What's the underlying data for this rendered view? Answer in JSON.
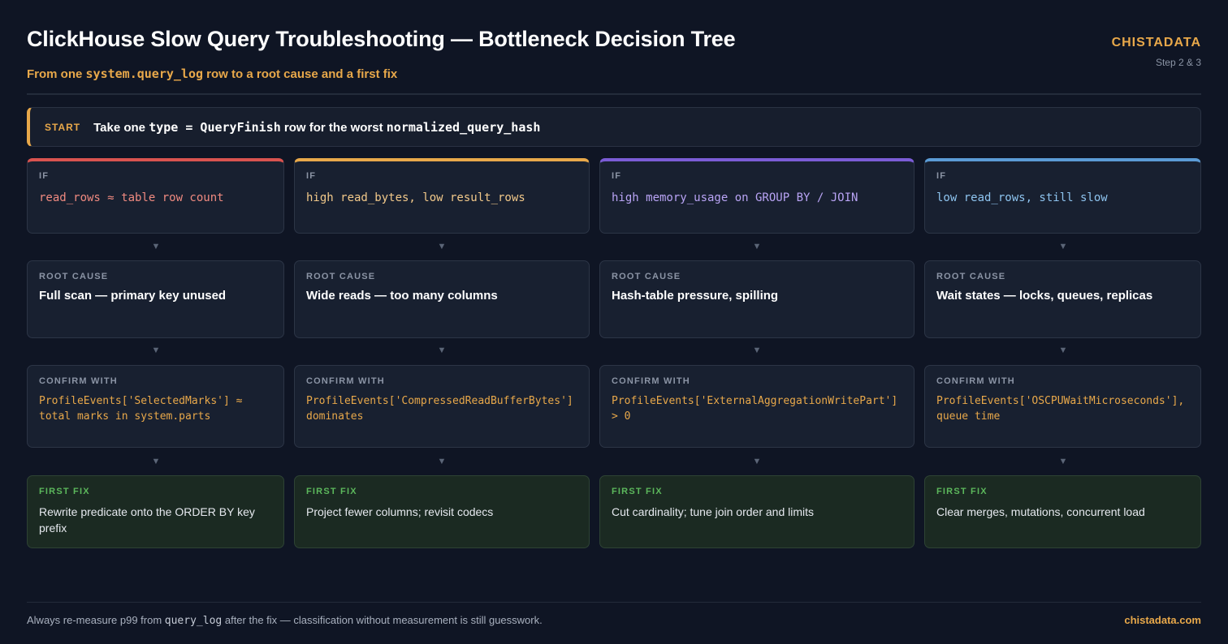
{
  "header": {
    "title": "ClickHouse Slow Query Troubleshooting — Bottleneck Decision Tree",
    "subtitle_pre": "From one ",
    "subtitle_code": "system.query_log",
    "subtitle_post": " row to a root cause and a first fix",
    "brand": "CHISTADATA",
    "step": "Step 2 & 3"
  },
  "start": {
    "tag": "START",
    "text_pre": "Take one ",
    "text_code": "type = QueryFinish",
    "text_mid": " row for the worst ",
    "text_code2": "normalized_query_hash"
  },
  "labels": {
    "if": "IF",
    "root_cause": "ROOT CAUSE",
    "confirm_with": "CONFIRM WITH",
    "first_fix": "FIRST FIX"
  },
  "colors": {
    "accent": "#e8a84a",
    "branch_1": "#d9534f",
    "branch_2": "#e8a84a",
    "branch_3": "#7b5cd6",
    "branch_4": "#5b9bd5"
  },
  "branches": [
    {
      "condition": "read_rows ≈ table row count",
      "cause": "Full scan — primary key unused",
      "confirm": "ProfileEvents['SelectedMarks'] ≈ total marks in system.parts",
      "fix": "Rewrite predicate onto the ORDER BY key prefix"
    },
    {
      "condition": "high read_bytes, low result_rows",
      "cause": "Wide reads — too many columns",
      "confirm": "ProfileEvents['CompressedReadBufferBytes'] dominates",
      "fix": "Project fewer columns; revisit codecs"
    },
    {
      "condition": "high memory_usage on GROUP BY / JOIN",
      "cause": "Hash-table pressure, spilling",
      "confirm": "ProfileEvents['ExternalAggregationWritePart'] > 0",
      "fix": "Cut cardinality; tune join order and limits"
    },
    {
      "condition": "low read_rows, still slow",
      "cause": "Wait states — locks, queues, replicas",
      "confirm": "ProfileEvents['OSCPUWaitMicroseconds'], queue time",
      "fix": "Clear merges, mutations, concurrent load"
    }
  ],
  "footer": {
    "note_pre": "Always re-measure p99 from ",
    "note_code": "query_log",
    "note_post": " after the fix — classification without measurement is still guesswork.",
    "url": "chistadata.com"
  }
}
